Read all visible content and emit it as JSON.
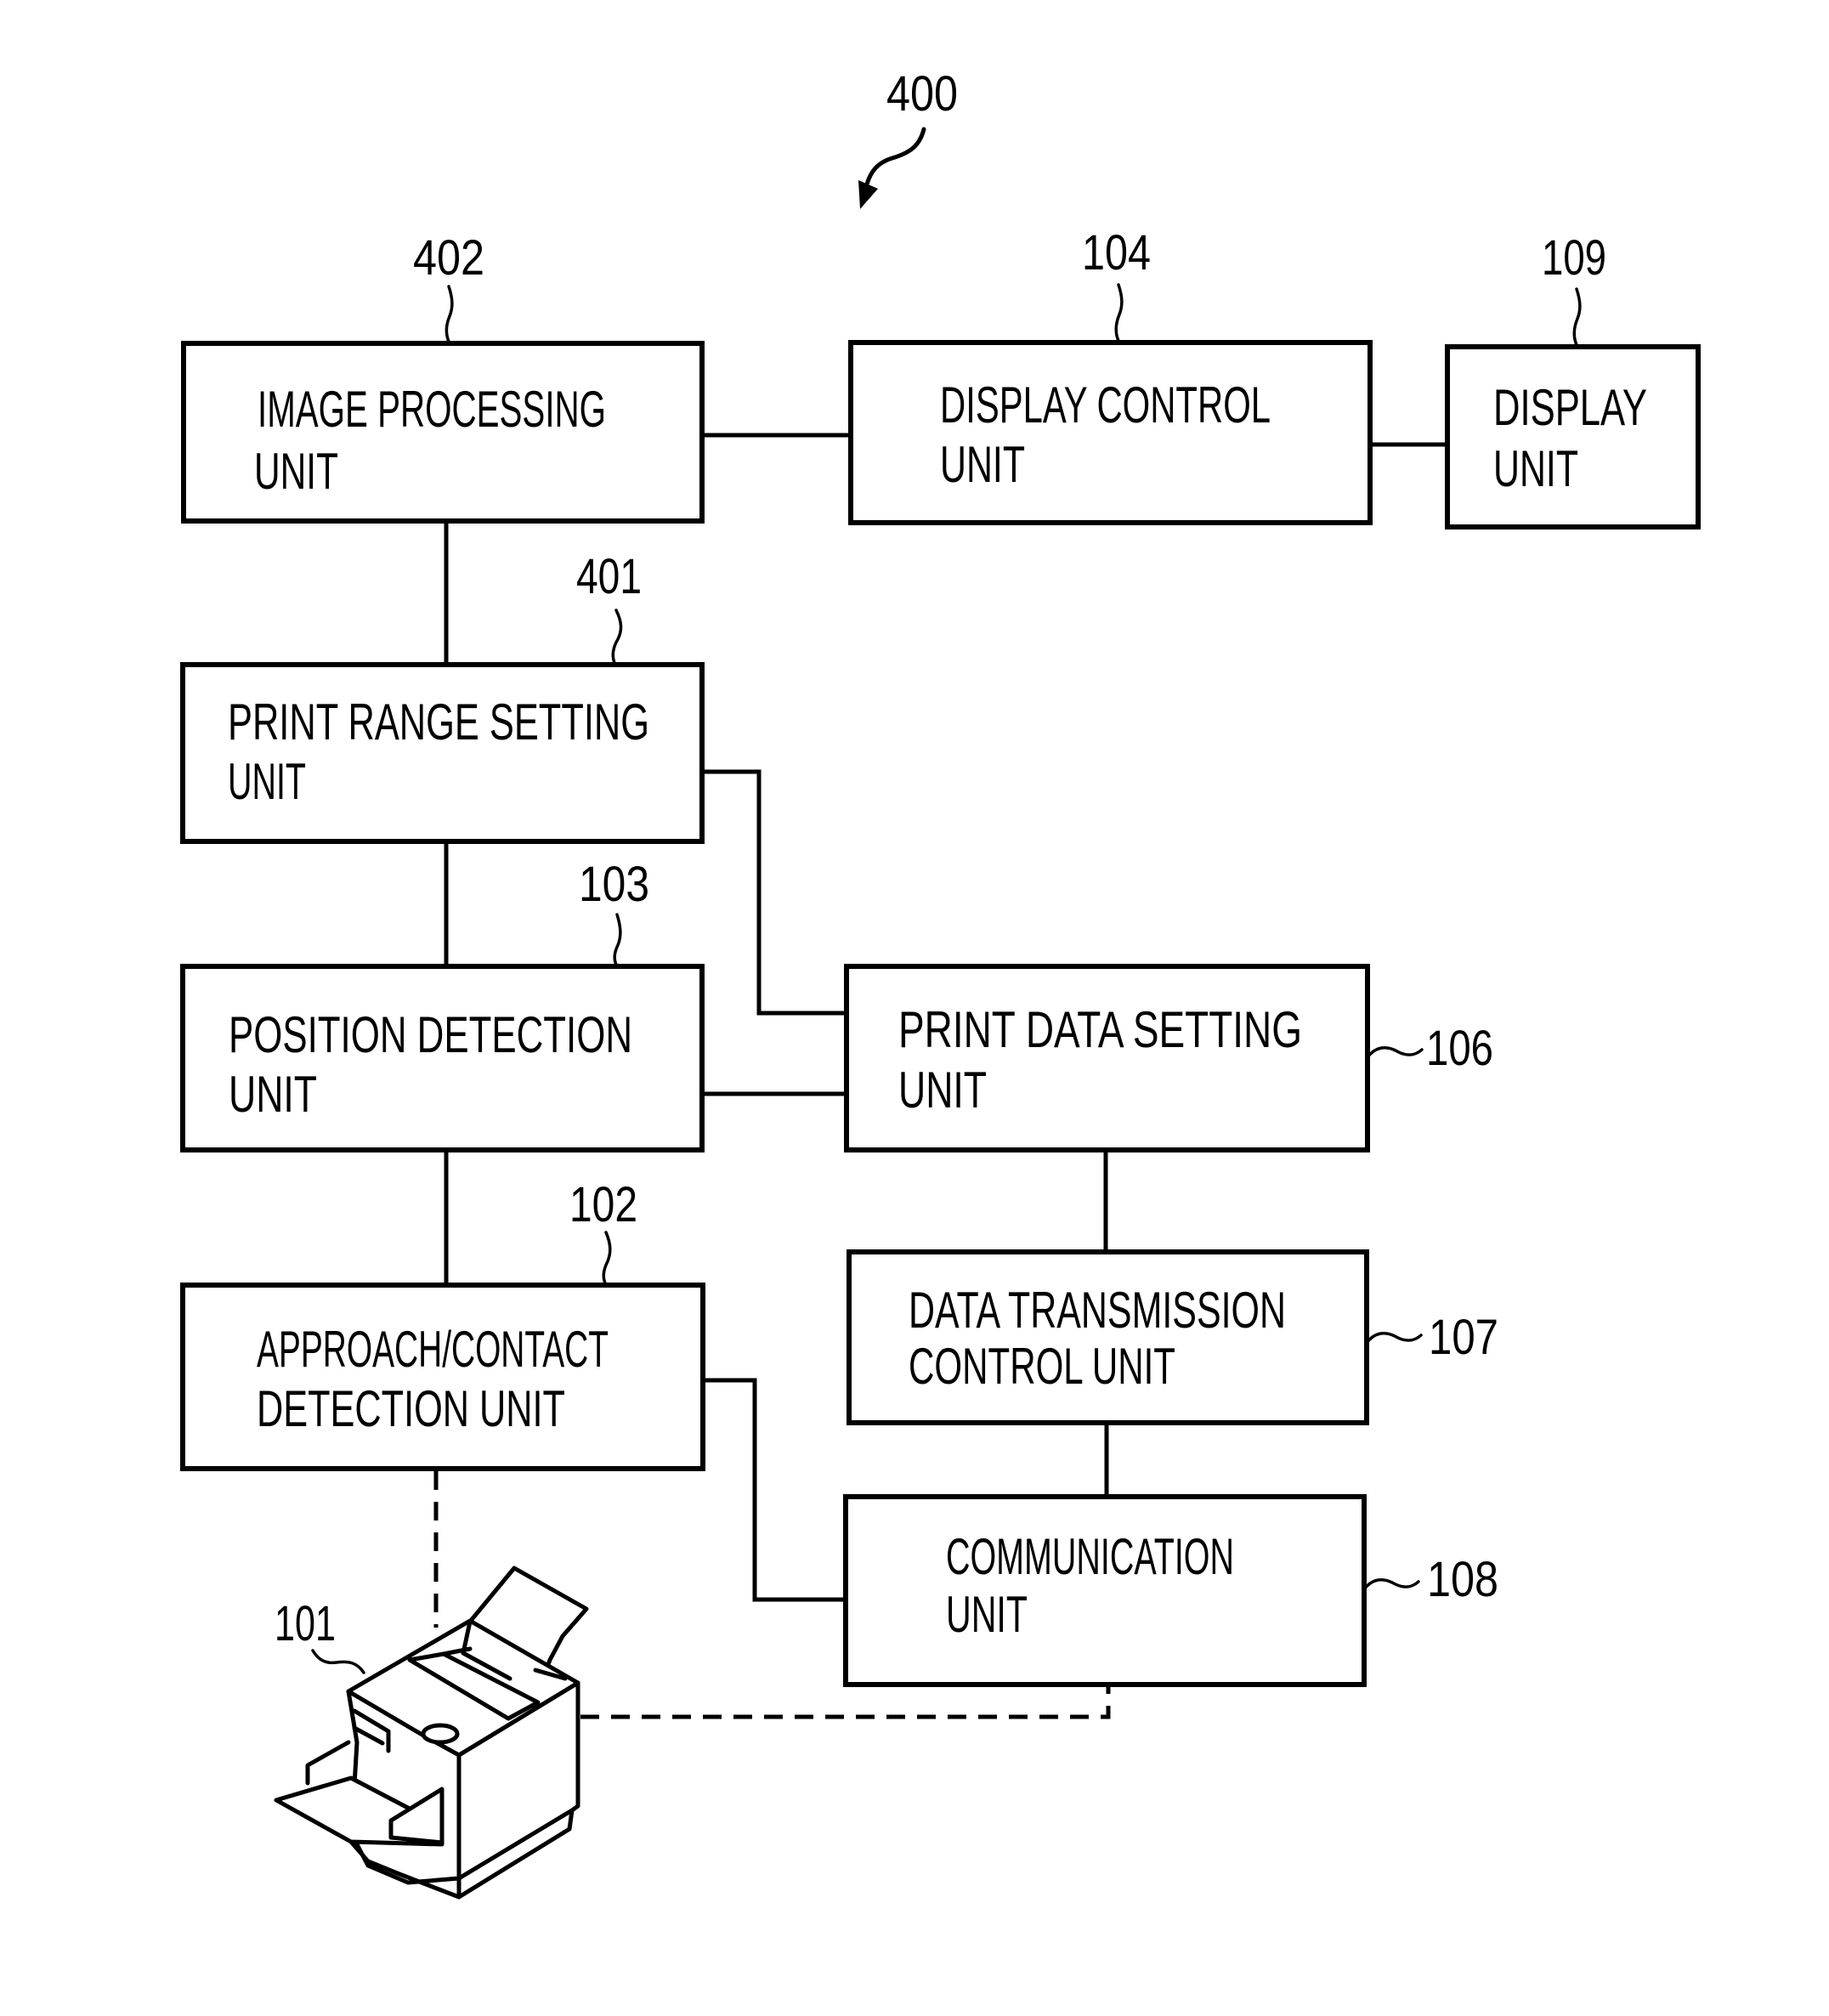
{
  "figure": {
    "reference": "400",
    "colors": {
      "line": "#000000",
      "background": "#ffffff"
    }
  },
  "blocks": {
    "image_processing": {
      "ref": "402",
      "lines": [
        "IMAGE PROCESSING",
        "UNIT"
      ]
    },
    "display_control": {
      "ref": "104",
      "lines": [
        "DISPLAY CONTROL",
        "UNIT"
      ]
    },
    "display": {
      "ref": "109",
      "lines": [
        "DISPLAY",
        "UNIT"
      ]
    },
    "print_range_setting": {
      "ref": "401",
      "lines": [
        "PRINT RANGE SETTING",
        "UNIT"
      ]
    },
    "position_detection": {
      "ref": "103",
      "lines": [
        "POSITION DETECTION",
        "UNIT"
      ]
    },
    "print_data_setting": {
      "ref": "106",
      "lines": [
        "PRINT DATA SETTING",
        "UNIT"
      ]
    },
    "approach_contact_detection": {
      "ref": "102",
      "lines": [
        "APPROACH/CONTACT",
        "DETECTION UNIT"
      ]
    },
    "data_transmission_control": {
      "ref": "107",
      "lines": [
        "DATA TRANSMISSION",
        "CONTROL UNIT"
      ]
    },
    "communication": {
      "ref": "108",
      "lines": [
        "COMMUNICATION",
        "UNIT"
      ]
    }
  },
  "device": {
    "ref": "101",
    "icon": "printer-icon"
  },
  "connections": [
    {
      "from": "image_processing",
      "to": "display_control",
      "style": "solid"
    },
    {
      "from": "display_control",
      "to": "display",
      "style": "solid"
    },
    {
      "from": "image_processing",
      "to": "print_range_setting",
      "style": "solid"
    },
    {
      "from": "print_range_setting",
      "to": "position_detection",
      "style": "solid"
    },
    {
      "from": "print_range_setting",
      "to": "print_data_setting",
      "style": "solid"
    },
    {
      "from": "position_detection",
      "to": "approach_contact_detection",
      "style": "solid"
    },
    {
      "from": "position_detection",
      "to": "print_data_setting",
      "style": "solid"
    },
    {
      "from": "print_data_setting",
      "to": "data_transmission_control",
      "style": "solid"
    },
    {
      "from": "data_transmission_control",
      "to": "communication",
      "style": "solid"
    },
    {
      "from": "approach_contact_detection",
      "to": "communication",
      "style": "solid"
    },
    {
      "from": "approach_contact_detection",
      "to": "device",
      "style": "dashed"
    },
    {
      "from": "device",
      "to": "communication",
      "style": "dashed"
    }
  ]
}
